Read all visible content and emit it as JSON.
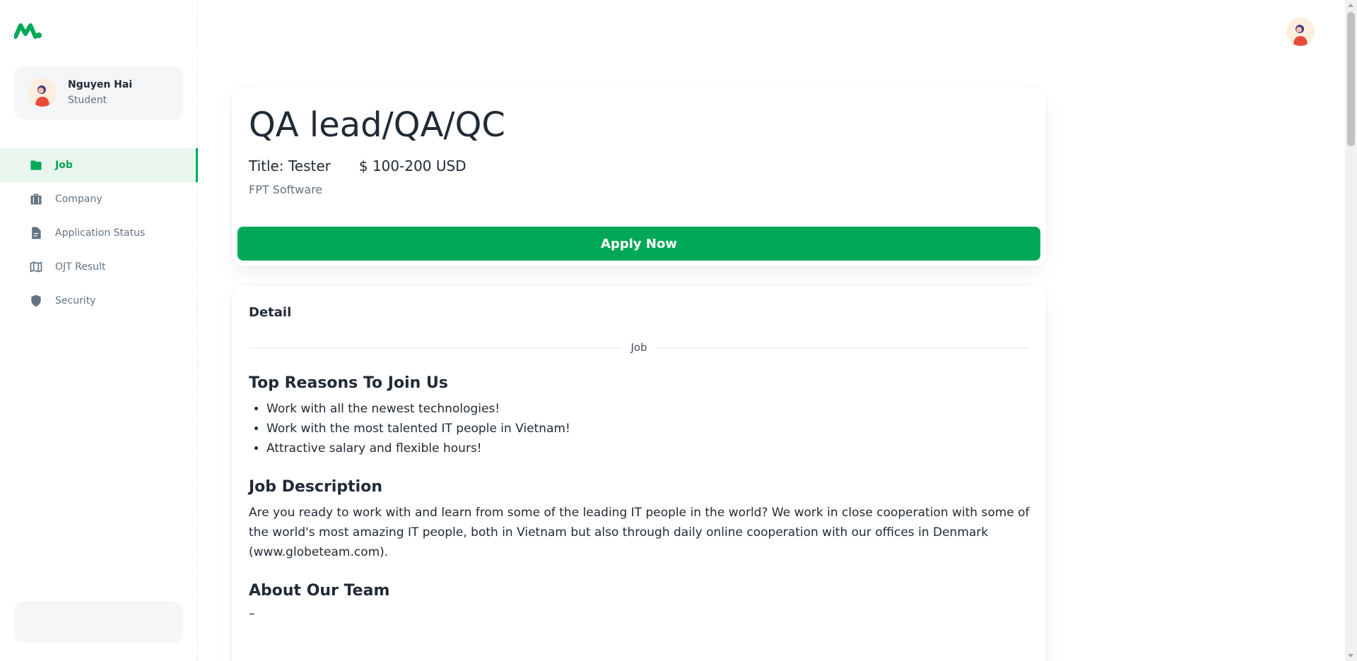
{
  "user": {
    "name": "Nguyen Hai",
    "role": "Student"
  },
  "nav": {
    "items": [
      {
        "label": "Job",
        "icon": "folder-icon",
        "active": true
      },
      {
        "label": "Company",
        "icon": "briefcase-icon"
      },
      {
        "label": "Application Status",
        "icon": "document-icon"
      },
      {
        "label": "OJT Result",
        "icon": "map-icon"
      },
      {
        "label": "Security",
        "icon": "shield-icon"
      }
    ]
  },
  "job": {
    "title": "QA lead/QA/QC",
    "position": "Title: Tester",
    "salary": "$ 100-200 USD",
    "company": "FPT Software",
    "apply_label": "Apply Now"
  },
  "detail": {
    "label": "Detail",
    "divider": "Job",
    "reasons_heading": "Top Reasons To Join Us",
    "reasons": [
      "Work with all the newest technologies!",
      "Work with the most talented IT people in Vietnam!",
      "Attractive salary and flexible hours!"
    ],
    "description_heading": "Job Description",
    "description": "Are you ready to work with and learn from some of the leading IT people in the world? We work in close cooperation with some of the world's most amazing IT people, both in Vietnam but also through daily online cooperation with our offices in Denmark (www.globeteam.com).",
    "team_heading": "About Our Team",
    "team_text": "–"
  },
  "colors": {
    "accent": "#00a857",
    "accent_light": "#e8f6ee",
    "text": "#212b36",
    "muted": "#637381"
  }
}
